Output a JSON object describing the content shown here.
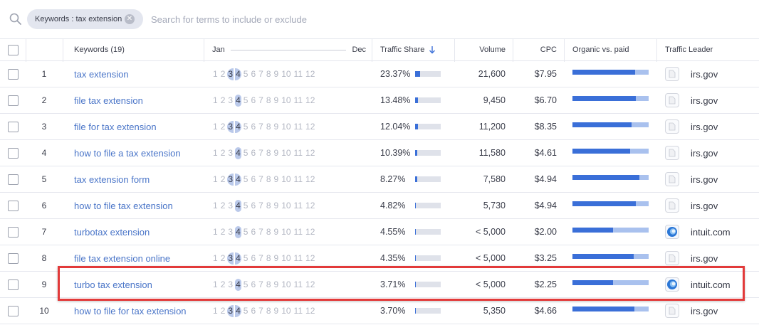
{
  "search": {
    "chip_label": "Keywords : tax extension",
    "placeholder": "Search for terms to include or exclude"
  },
  "table": {
    "headers": {
      "keywords": "Keywords (19)",
      "month_start": "Jan",
      "month_end": "Dec",
      "traffic_share": "Traffic Share",
      "volume": "Volume",
      "cpc": "CPC",
      "organic_paid": "Organic vs. paid",
      "traffic_leader": "Traffic Leader"
    },
    "months": [
      "1",
      "2",
      "3",
      "4",
      "5",
      "6",
      "7",
      "8",
      "9",
      "10",
      "11",
      "12"
    ],
    "colors": {
      "accent": "#3a6fd8",
      "link": "#4a75c8",
      "month_selected": "#bac9ea",
      "highlight": "#e23a3a"
    },
    "rows": [
      {
        "num": "1",
        "keyword": "tax extension",
        "sel_months": [
          3,
          4
        ],
        "share": "23.37%",
        "share_frac": 0.19,
        "volume": "21,600",
        "cpc": "$7.95",
        "organic_frac": 0.82,
        "leader": "irs.gov",
        "leader_icon": "doc-icon"
      },
      {
        "num": "2",
        "keyword": "file tax extension",
        "sel_months": [
          4
        ],
        "share": "13.48%",
        "share_frac": 0.11,
        "volume": "9,450",
        "cpc": "$6.70",
        "organic_frac": 0.83,
        "leader": "irs.gov",
        "leader_icon": "doc-icon"
      },
      {
        "num": "3",
        "keyword": "file for tax extension",
        "sel_months": [
          3,
          4
        ],
        "share": "12.04%",
        "share_frac": 0.1,
        "volume": "11,200",
        "cpc": "$8.35",
        "organic_frac": 0.78,
        "leader": "irs.gov",
        "leader_icon": "doc-icon"
      },
      {
        "num": "4",
        "keyword": "how to file a tax extension",
        "sel_months": [
          4
        ],
        "share": "10.39%",
        "share_frac": 0.08,
        "volume": "11,580",
        "cpc": "$4.61",
        "organic_frac": 0.76,
        "leader": "irs.gov",
        "leader_icon": "doc-icon"
      },
      {
        "num": "5",
        "keyword": "tax extension form",
        "sel_months": [
          3,
          4
        ],
        "share": "8.27%",
        "share_frac": 0.07,
        "volume": "7,580",
        "cpc": "$4.94",
        "organic_frac": 0.88,
        "leader": "irs.gov",
        "leader_icon": "doc-icon"
      },
      {
        "num": "6",
        "keyword": "how to file tax extension",
        "sel_months": [
          4
        ],
        "share": "4.82%",
        "share_frac": 0.04,
        "volume": "5,730",
        "cpc": "$4.94",
        "organic_frac": 0.83,
        "leader": "irs.gov",
        "leader_icon": "doc-icon"
      },
      {
        "num": "7",
        "keyword": "turbotax extension",
        "sel_months": [
          4
        ],
        "share": "4.55%",
        "share_frac": 0.04,
        "volume": "< 5,000",
        "cpc": "$2.00",
        "organic_frac": 0.53,
        "leader": "intuit.com",
        "leader_icon": "intuit-logo-icon"
      },
      {
        "num": "8",
        "keyword": "file tax extension online",
        "sel_months": [
          3,
          4
        ],
        "share": "4.35%",
        "share_frac": 0.04,
        "volume": "< 5,000",
        "cpc": "$3.25",
        "organic_frac": 0.8,
        "leader": "irs.gov",
        "leader_icon": "doc-icon"
      },
      {
        "num": "9",
        "keyword": "turbo tax extension",
        "sel_months": [
          4
        ],
        "share": "3.71%",
        "share_frac": 0.03,
        "volume": "< 5,000",
        "cpc": "$2.25",
        "organic_frac": 0.53,
        "leader": "intuit.com",
        "leader_icon": "intuit-logo-icon"
      },
      {
        "num": "10",
        "keyword": "how to file for tax extension",
        "sel_months": [
          3,
          4
        ],
        "share": "3.70%",
        "share_frac": 0.03,
        "volume": "5,350",
        "cpc": "$4.66",
        "organic_frac": 0.81,
        "leader": "irs.gov",
        "leader_icon": "doc-icon"
      }
    ]
  }
}
